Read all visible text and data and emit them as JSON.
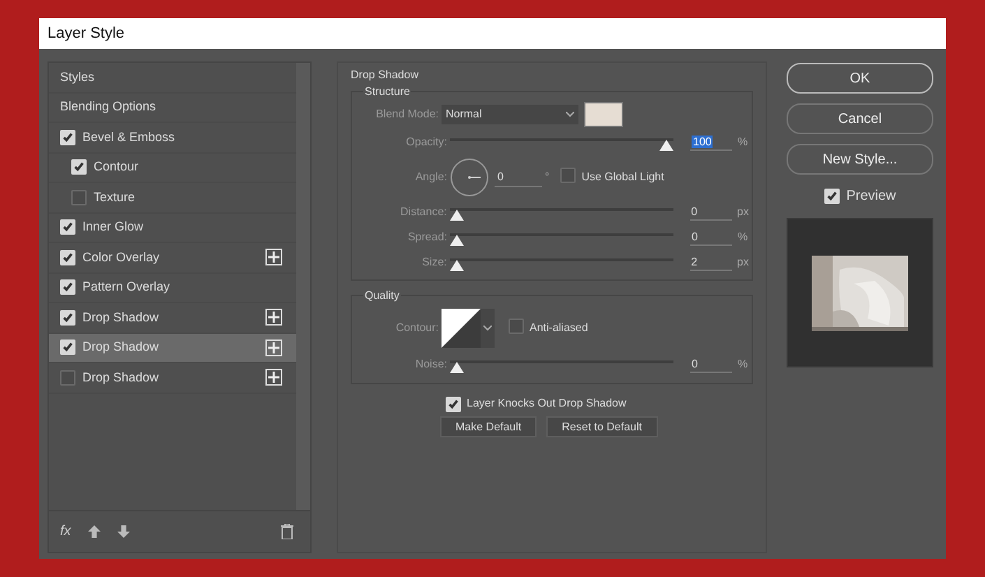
{
  "window": {
    "title": "Layer Style"
  },
  "styles": [
    {
      "kind": "header",
      "label": "Styles",
      "selected": false
    },
    {
      "kind": "header",
      "label": "Blending Options",
      "selected": false
    },
    {
      "kind": "check",
      "label": "Bevel & Emboss",
      "checked": true,
      "selected": false,
      "addable": false,
      "children": [
        {
          "kind": "check",
          "label": "Contour",
          "checked": true,
          "selected": false,
          "addable": false
        },
        {
          "kind": "check",
          "label": "Texture",
          "checked": false,
          "selected": false,
          "addable": false
        }
      ]
    },
    {
      "kind": "check",
      "label": "Inner Glow",
      "checked": true,
      "selected": false,
      "addable": false
    },
    {
      "kind": "check",
      "label": "Color Overlay",
      "checked": true,
      "selected": false,
      "addable": true
    },
    {
      "kind": "check",
      "label": "Pattern Overlay",
      "checked": true,
      "selected": false,
      "addable": false
    },
    {
      "kind": "check",
      "label": "Drop Shadow",
      "checked": true,
      "selected": false,
      "addable": true
    },
    {
      "kind": "check",
      "label": "Drop Shadow",
      "checked": true,
      "selected": true,
      "addable": true
    },
    {
      "kind": "check",
      "label": "Drop Shadow",
      "checked": false,
      "selected": false,
      "addable": true
    }
  ],
  "fx_label": "fx",
  "panel": {
    "title": "Drop Shadow",
    "structure": {
      "legend": "Structure",
      "blend_label": "Blend Mode:",
      "blend_mode": "Normal",
      "color": "#e6ddd3",
      "opacity": {
        "label": "Opacity:",
        "level": 1,
        "value": "100",
        "unit": "%",
        "value_selected": true
      },
      "angle": {
        "label": "Angle:",
        "value": "0",
        "unit": "°",
        "global_label": "Use Global Light",
        "global_checked": false
      },
      "sliders": [
        {
          "label": "Distance:",
          "level": 0,
          "value": "0",
          "unit": "px"
        },
        {
          "label": "Spread:",
          "level": 0,
          "value": "0",
          "unit": "%"
        },
        {
          "label": "Size:",
          "level": 0,
          "value": "2",
          "unit": "px"
        }
      ]
    },
    "quality": {
      "legend": "Quality",
      "contour_label": "Contour:",
      "anti_label": "Anti-aliased",
      "anti_checked": false,
      "noise": {
        "label": "Noise:",
        "level": 0,
        "value": "0",
        "unit": "%"
      }
    },
    "knockout": {
      "label": "Layer Knocks Out Drop Shadow",
      "checked": true
    },
    "buttons": [
      "Make Default",
      "Reset to Default"
    ]
  },
  "actions": [
    "OK",
    "Cancel",
    "New Style..."
  ],
  "preview": {
    "label": "Preview",
    "checked": true
  }
}
